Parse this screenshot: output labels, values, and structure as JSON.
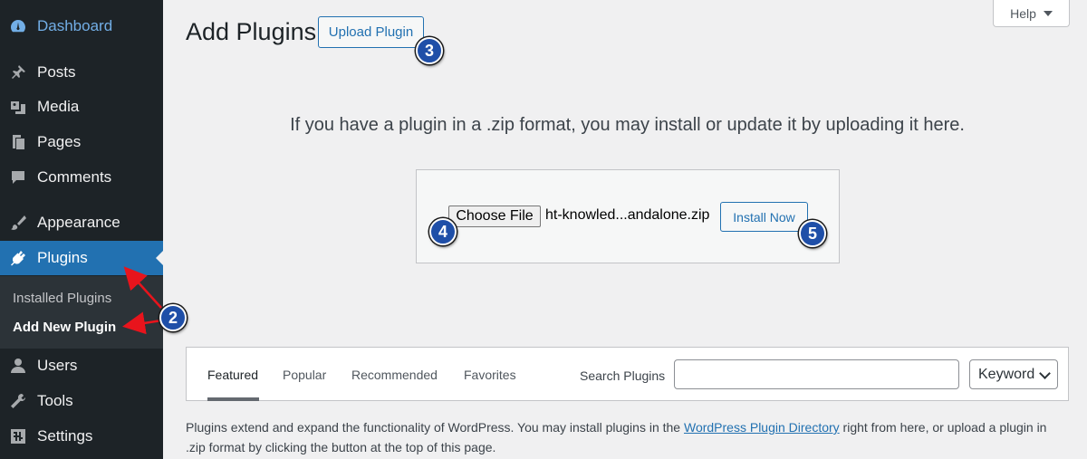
{
  "sidebar": {
    "items": [
      {
        "label": "Dashboard",
        "icon": "dashboard-icon"
      },
      {
        "label": "Posts",
        "icon": "pin-icon"
      },
      {
        "label": "Media",
        "icon": "media-icon"
      },
      {
        "label": "Pages",
        "icon": "pages-icon"
      },
      {
        "label": "Comments",
        "icon": "comments-icon"
      },
      {
        "label": "Appearance",
        "icon": "brush-icon"
      },
      {
        "label": "Plugins",
        "icon": "plugin-icon",
        "active": true
      },
      {
        "label": "Users",
        "icon": "users-icon"
      },
      {
        "label": "Tools",
        "icon": "wrench-icon"
      },
      {
        "label": "Settings",
        "icon": "settings-icon"
      }
    ],
    "submenu": [
      {
        "label": "Installed Plugins"
      },
      {
        "label": "Add New Plugin",
        "current": true
      }
    ]
  },
  "header": {
    "title": "Add Plugins",
    "upload_button": "Upload Plugin",
    "help_button": "Help"
  },
  "upload": {
    "help_text": "If you have a plugin in a .zip format, you may install or update it by uploading it here.",
    "choose_file_button": "Choose File",
    "file_name": "ht-knowled...andalone.zip",
    "install_button": "Install Now"
  },
  "annotations": {
    "badges": [
      "2",
      "3",
      "4",
      "5"
    ],
    "arrow_color": "#e8141c",
    "badge_color": "#1f4fa8"
  },
  "filter": {
    "tabs": [
      "Featured",
      "Popular",
      "Recommended",
      "Favorites"
    ],
    "current_tab": "Featured",
    "search_label": "Search Plugins",
    "search_value": "",
    "select_value": "Keyword"
  },
  "description": {
    "text_before": "Plugins extend and expand the functionality of WordPress. You may install plugins in the ",
    "link": "WordPress Plugin Directory",
    "text_after": " right from here, or upload a plugin in .zip format by clicking the button at the top of this page."
  },
  "colors": {
    "sidebar_bg": "#1d2327",
    "active_bg": "#2271b1",
    "accent": "#2271b1",
    "page_bg": "#f0f0f1"
  }
}
